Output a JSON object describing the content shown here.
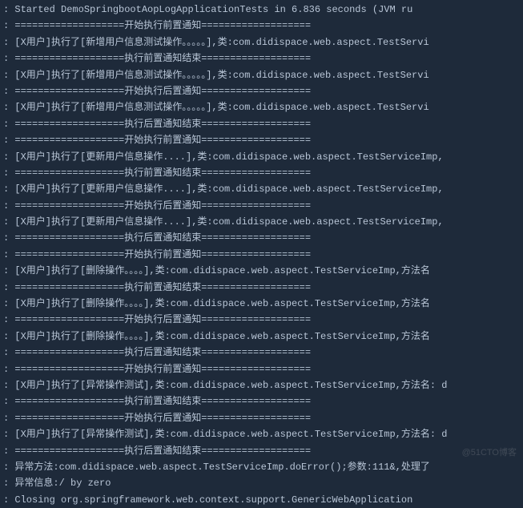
{
  "watermark": "@51CTO博客",
  "lines": [
    ": Started DemoSpringbootAopLogApplicationTests in 6.836 seconds (JVM ru",
    ": ===================开始执行前置通知===================",
    ": [X用户]执行了[新增用户信息测试操作。。。。。],类:com.didispace.web.aspect.TestServi",
    ": ===================执行前置通知结束===================",
    ": [X用户]执行了[新增用户信息测试操作。。。。。],类:com.didispace.web.aspect.TestServi",
    ": ===================开始执行后置通知===================",
    ": [X用户]执行了[新增用户信息测试操作。。。。。],类:com.didispace.web.aspect.TestServi",
    ": ===================执行后置通知结束===================",
    ": ===================开始执行前置通知===================",
    ": [X用户]执行了[更新用户信息操作....],类:com.didispace.web.aspect.TestServiceImp,",
    ": ===================执行前置通知结束===================",
    ": [X用户]执行了[更新用户信息操作....],类:com.didispace.web.aspect.TestServiceImp,",
    ": ===================开始执行后置通知===================",
    ": [X用户]执行了[更新用户信息操作....],类:com.didispace.web.aspect.TestServiceImp,",
    ": ===================执行后置通知结束===================",
    ": ===================开始执行前置通知===================",
    ": [X用户]执行了[删除操作。。。。],类:com.didispace.web.aspect.TestServiceImp,方法名",
    ": ===================执行前置通知结束===================",
    ": [X用户]执行了[删除操作。。。。],类:com.didispace.web.aspect.TestServiceImp,方法名",
    ": ===================开始执行后置通知===================",
    ": [X用户]执行了[删除操作。。。。],类:com.didispace.web.aspect.TestServiceImp,方法名",
    ": ===================执行后置通知结束===================",
    ": ===================开始执行前置通知===================",
    ": [X用户]执行了[异常操作测试],类:com.didispace.web.aspect.TestServiceImp,方法名: d",
    ": ===================执行前置通知结束===================",
    ": ===================开始执行后置通知===================",
    ": [X用户]执行了[异常操作测试],类:com.didispace.web.aspect.TestServiceImp,方法名: d",
    ": ===================执行后置通知结束===================",
    ": 异常方法:com.didispace.web.aspect.TestServiceImp.doError();参数:111&,处理了",
    ": 异常信息:/ by zero",
    ": Closing org.springframework.web.context.support.GenericWebApplication"
  ]
}
